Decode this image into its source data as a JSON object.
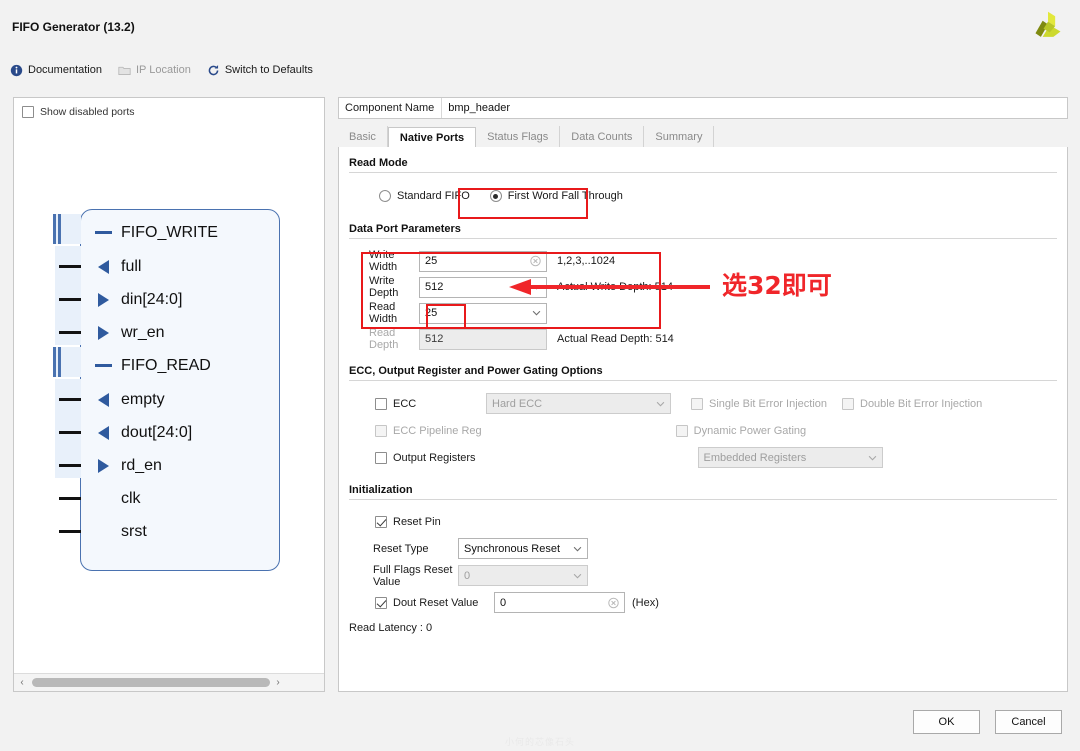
{
  "window": {
    "title": "FIFO Generator (13.2)",
    "logo_icon": "xilinx-logo",
    "watermark": "小何的芯像石头"
  },
  "toolbar": {
    "items": [
      {
        "label": "Documentation",
        "icon": "info-icon",
        "disabled": false
      },
      {
        "label": "IP Location",
        "icon": "folder-icon",
        "disabled": true
      },
      {
        "label": "Switch to Defaults",
        "icon": "refresh-icon",
        "disabled": false
      }
    ]
  },
  "left_panel": {
    "show_disabled_ports": {
      "label": "Show disabled ports",
      "checked": false
    },
    "symbol": {
      "groups": [
        {
          "name": "FIFO_WRITE",
          "kind": "bus-group",
          "ports": [
            {
              "label": "full",
              "dir": "out"
            },
            {
              "label": "din[24:0]",
              "dir": "in"
            },
            {
              "label": "wr_en",
              "dir": "in"
            }
          ]
        },
        {
          "name": "FIFO_READ",
          "kind": "bus-group",
          "ports": [
            {
              "label": "empty",
              "dir": "out"
            },
            {
              "label": "dout[24:0]",
              "dir": "out"
            },
            {
              "label": "rd_en",
              "dir": "in"
            }
          ]
        }
      ],
      "single_pins": [
        {
          "label": "clk"
        },
        {
          "label": "srst"
        }
      ]
    },
    "scrollbar": {
      "left_arrow": "‹",
      "right_arrow": "›"
    }
  },
  "component": {
    "name_label": "Component Name",
    "name_value": "bmp_header"
  },
  "tabs": [
    {
      "label": "Basic",
      "active": false
    },
    {
      "label": "Native Ports",
      "active": true
    },
    {
      "label": "Status Flags",
      "active": false
    },
    {
      "label": "Data Counts",
      "active": false
    },
    {
      "label": "Summary",
      "active": false
    }
  ],
  "read_mode": {
    "title": "Read Mode",
    "options": [
      {
        "label": "Standard FIFO",
        "selected": false
      },
      {
        "label": "First Word Fall Through",
        "selected": true
      }
    ]
  },
  "data_port_parameters": {
    "title": "Data Port Parameters",
    "write_width": {
      "label": "Write Width",
      "value": "25",
      "hint": "1,2,3,..1024",
      "clear_icon": "clear-circle-icon"
    },
    "write_depth": {
      "label": "Write Depth",
      "value": "512",
      "hint": "Actual Write Depth: 514"
    },
    "read_width": {
      "label": "Read Width",
      "value": "25"
    },
    "read_depth": {
      "label": "Read Depth",
      "value": "512",
      "hint": "Actual Read Depth: 514",
      "disabled": true
    }
  },
  "ecc_section": {
    "title": "ECC, Output Register and Power Gating Options",
    "ecc": {
      "label": "ECC",
      "checked": false
    },
    "ecc_type": {
      "value": "Hard ECC",
      "disabled": true
    },
    "single_bit": {
      "label": "Single Bit Error Injection",
      "checked": false,
      "disabled": true
    },
    "double_bit": {
      "label": "Double Bit Error Injection",
      "checked": false,
      "disabled": true
    },
    "ecc_pipeline": {
      "label": "ECC Pipeline Reg",
      "checked": false,
      "disabled": true
    },
    "dynamic_power": {
      "label": "Dynamic Power Gating",
      "checked": false,
      "disabled": true
    },
    "output_registers": {
      "label": "Output Registers",
      "checked": false
    },
    "output_reg_type": {
      "value": "Embedded Registers",
      "disabled": true
    }
  },
  "initialization": {
    "title": "Initialization",
    "reset_pin": {
      "label": "Reset Pin",
      "checked": true
    },
    "reset_type": {
      "label": "Reset Type",
      "value": "Synchronous Reset"
    },
    "full_flags_reset": {
      "label": "Full Flags Reset Value",
      "value": "0",
      "disabled": true
    },
    "dout_reset": {
      "label": "Dout Reset Value",
      "value": "0",
      "checked": true,
      "suffix": "(Hex)",
      "clear_icon": "clear-circle-icon"
    },
    "read_latency": "Read Latency : 0"
  },
  "annotation": {
    "text": "选32即可",
    "color": "#f0262a"
  },
  "footer": {
    "ok_label": "OK",
    "cancel_label": "Cancel"
  }
}
